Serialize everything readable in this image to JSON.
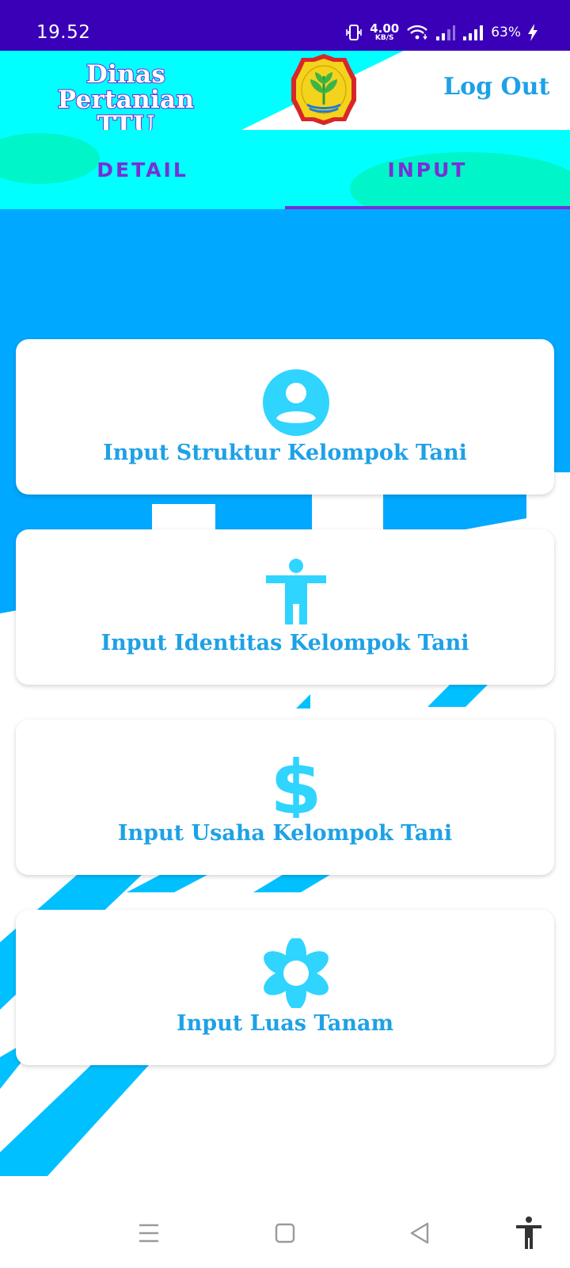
{
  "status_bar": {
    "time": "19.52",
    "net_speed_value": "4.00",
    "net_speed_unit": "KB/S",
    "battery_percent": "63%"
  },
  "header": {
    "title_line1": "Dinas Pertanian",
    "title_line2": "TTU",
    "logout_label": "Log Out"
  },
  "tabs": [
    {
      "label": "DETAIL",
      "selected": false
    },
    {
      "label": "INPUT",
      "selected": true
    }
  ],
  "cards": [
    {
      "label": "Input Struktur Kelompok Tani",
      "icon": "account-circle-icon"
    },
    {
      "label": "Input Identitas Kelompok Tani",
      "icon": "person-icon"
    },
    {
      "label": "Input Usaha Kelompok Tani",
      "icon": "dollar-icon"
    },
    {
      "label": "Input Luas Tanam",
      "icon": "flower-icon"
    }
  ],
  "colors": {
    "status_bar": "#3a00b8",
    "header_cyan": "#00ffff",
    "background_blue": "#00a8ff",
    "stripe_blue": "#00c0ff",
    "label_blue": "#1ea1e6",
    "icon_cyan": "#2fd4ff",
    "tab_purple": "#7a2ed6",
    "tab_bubble": "#00f5c8"
  }
}
